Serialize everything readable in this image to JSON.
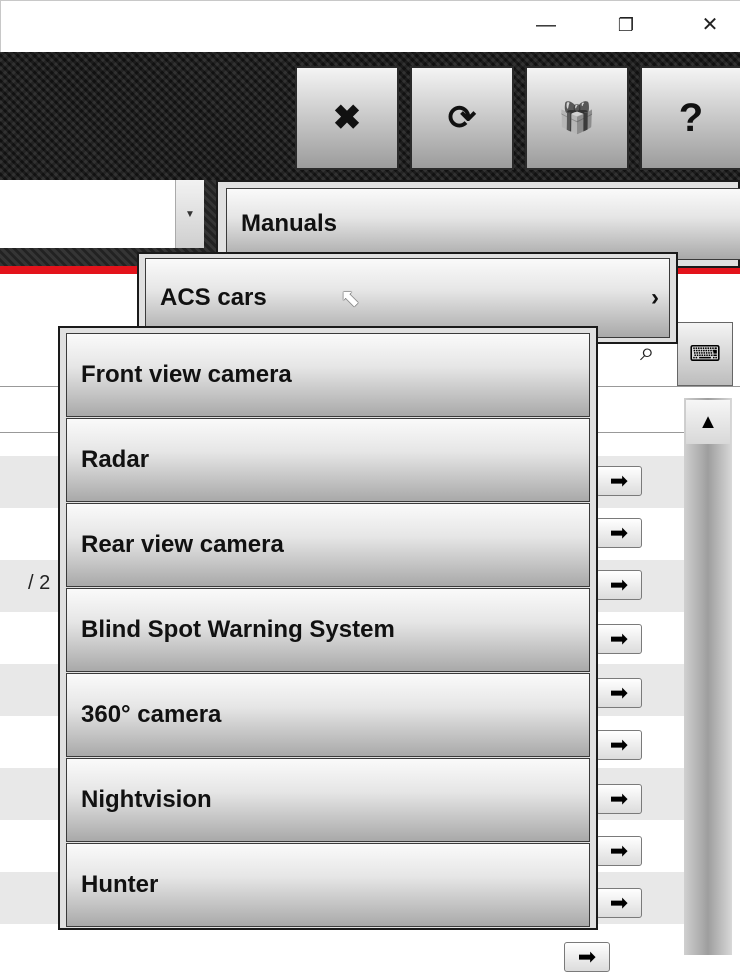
{
  "window": {
    "minimize_glyph": "—",
    "maximize_glyph": "❐",
    "close_glyph": "✕"
  },
  "toolbar": {
    "buttons": [
      {
        "icon": "tools-icon",
        "glyph": "✖"
      },
      {
        "icon": "sync-icon",
        "glyph": "⟳"
      },
      {
        "icon": "gift-icon",
        "glyph": "🎁"
      },
      {
        "icon": "help-icon",
        "glyph": "?"
      }
    ]
  },
  "menus": {
    "level1": {
      "label": "Manuals",
      "chevron": "›"
    },
    "level2": {
      "label": "ACS cars",
      "chevron": "›"
    },
    "level3": {
      "items": [
        "Front view camera",
        "Radar",
        "Rear view camera",
        "Blind Spot Warning System",
        "360° camera",
        "Nightvision",
        "Hunter"
      ]
    }
  },
  "background": {
    "partial_text": "/ 2"
  },
  "colors": {
    "accent_red": "#e3131b"
  }
}
